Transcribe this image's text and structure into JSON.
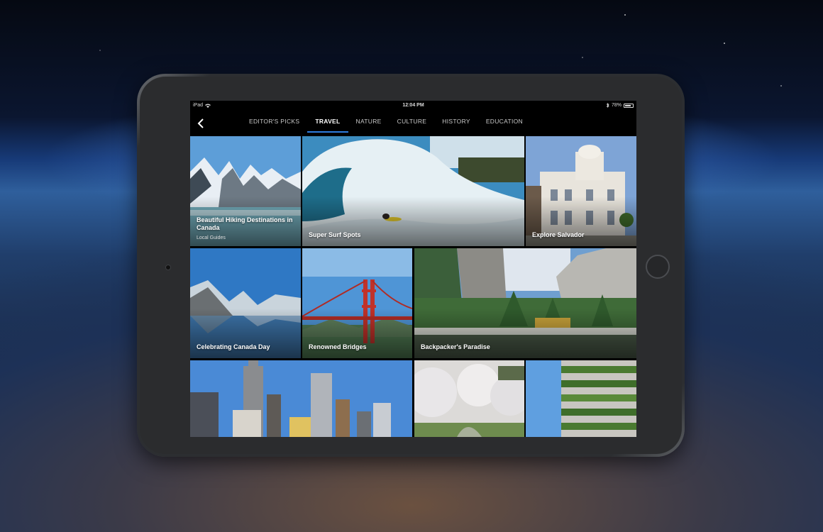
{
  "status_bar": {
    "device": "iPad",
    "time": "12:04 PM",
    "battery_percent": "78%",
    "battery_level": 0.78,
    "icons": [
      "wifi-icon",
      "bluetooth-icon",
      "battery-icon"
    ]
  },
  "nav": {
    "back_icon": "chevron-left-icon",
    "back_glyph": "‹",
    "tabs": [
      {
        "label": "EDITOR'S PICKS"
      },
      {
        "label": "TRAVEL"
      },
      {
        "label": "NATURE"
      },
      {
        "label": "CULTURE"
      },
      {
        "label": "HISTORY"
      },
      {
        "label": "EDUCATION"
      }
    ],
    "active_tab": "TRAVEL",
    "accent_color": "#2e7de0"
  },
  "tiles": [
    {
      "title": "Beautiful Hiking Destinations in Canada",
      "subtitle": "Local Guides",
      "image": "snowy mountains and lake"
    },
    {
      "title": "Super Surf Spots",
      "image": "surfer riding a big wave"
    },
    {
      "title": "Explore Salvador",
      "image": "white colonial building"
    },
    {
      "title": "Celebrating Canada Day",
      "image": "mountains reflected in lake"
    },
    {
      "title": "Renowned Bridges",
      "image": "red suspension bridge"
    },
    {
      "title": "Backpacker's Paradise",
      "image": "forest valley with cliffs"
    },
    {
      "title": "",
      "image": "city skyline"
    },
    {
      "title": "",
      "image": "cherry blossom trees"
    },
    {
      "title": "",
      "image": "green terraced building"
    }
  ]
}
